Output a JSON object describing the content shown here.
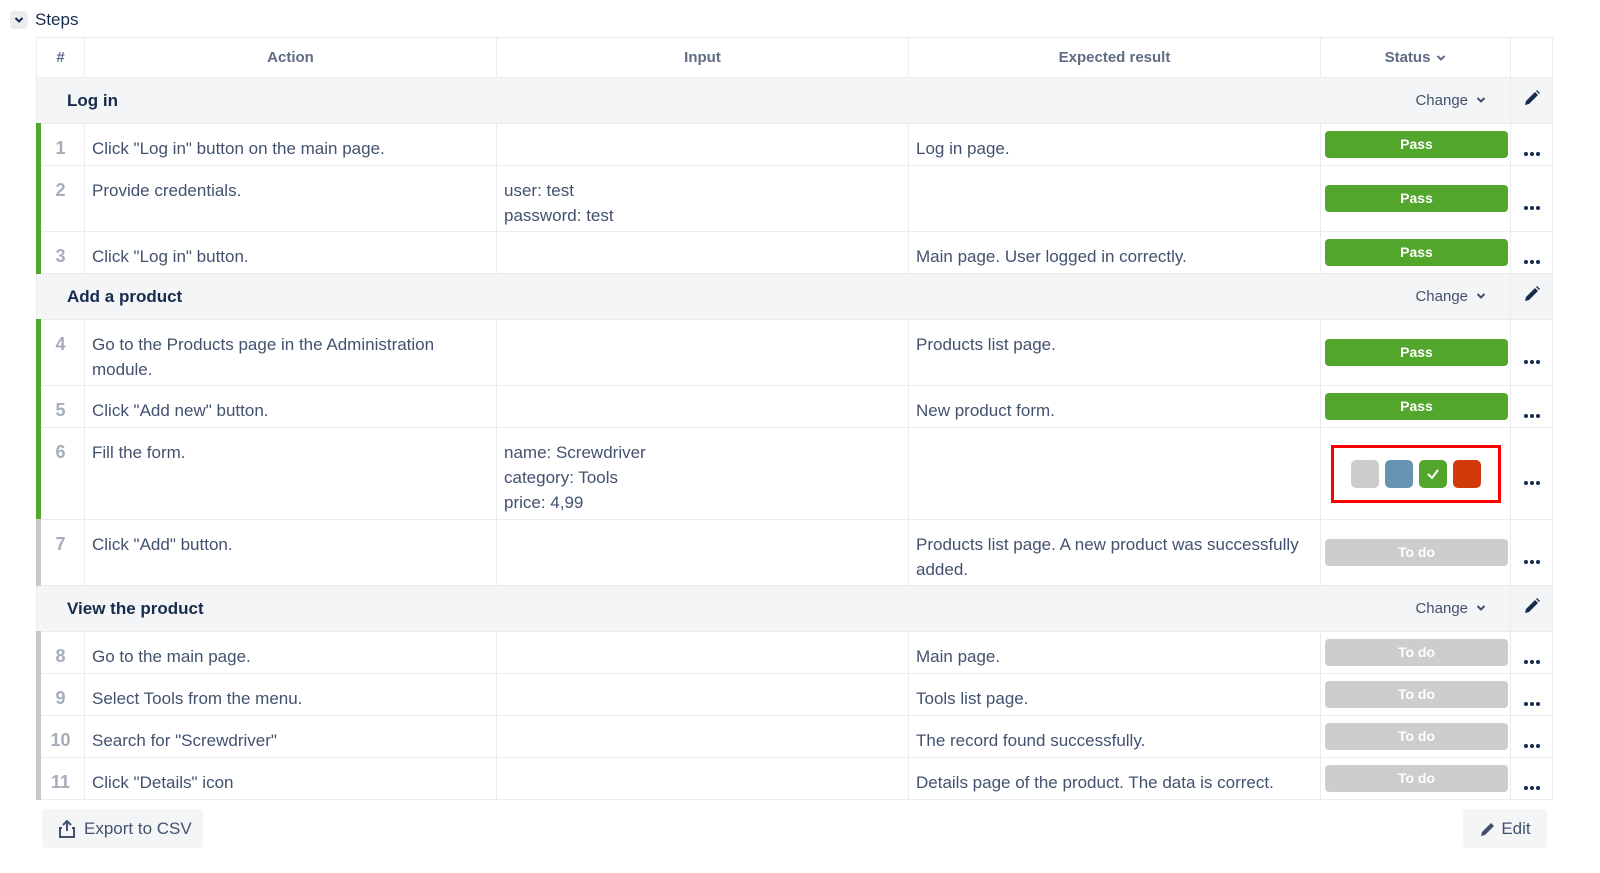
{
  "section": {
    "title": "Steps",
    "collapse_icon": "chevron-down-icon"
  },
  "table": {
    "headers": {
      "num": "#",
      "action": "Action",
      "input": "Input",
      "expected": "Expected result",
      "status": "Status"
    },
    "groups": [
      {
        "title": "Log in",
        "change_label": "Change",
        "steps": [
          {
            "num": "1",
            "action": "Click \"Log in\" button on the main page.",
            "input": [],
            "expected": "Log in page.",
            "status": "Pass"
          },
          {
            "num": "2",
            "action": "Provide credentials.",
            "input": [
              "user: test",
              "password: test"
            ],
            "expected": "",
            "status": "Pass"
          },
          {
            "num": "3",
            "action": "Click \"Log in\" button.",
            "input": [],
            "expected": "Main page. User logged in correctly.",
            "status": "Pass"
          }
        ]
      },
      {
        "title": "Add a product",
        "change_label": "Change",
        "steps": [
          {
            "num": "4",
            "action": "Go to the Products page in the Administration module.",
            "input": [],
            "expected": "Products list page.",
            "status": "Pass"
          },
          {
            "num": "5",
            "action": "Click \"Add new\" button.",
            "input": [],
            "expected": "New product form.",
            "status": "Pass"
          },
          {
            "num": "6",
            "action": "Fill the form.",
            "input": [
              "name: Screwdriver",
              "category: Tools",
              "price: 4,99"
            ],
            "expected": "",
            "status": "picker"
          },
          {
            "num": "7",
            "action": "Click \"Add\" button.",
            "input": [],
            "expected": "Products list page. A new product was successfully added.",
            "status": "To do"
          }
        ]
      },
      {
        "title": "View the product",
        "change_label": "Change",
        "steps": [
          {
            "num": "8",
            "action": "Go to the main page.",
            "input": [],
            "expected": "Main page.",
            "status": "To do"
          },
          {
            "num": "9",
            "action": "Select Tools from the menu.",
            "input": [],
            "expected": "Tools list page.",
            "status": "To do"
          },
          {
            "num": "10",
            "action": "Search for \"Screwdriver\"",
            "input": [],
            "expected": "The record found successfully.",
            "status": "To do"
          },
          {
            "num": "11",
            "action": "Click \"Details\" icon",
            "input": [],
            "expected": "Details page of the product. The data is correct.",
            "status": "To do"
          }
        ]
      }
    ]
  },
  "status_picker": {
    "options": [
      {
        "name": "to-do",
        "color": "#cccccc"
      },
      {
        "name": "in-progress",
        "color": "#6793b3"
      },
      {
        "name": "pass",
        "color": "#52a62b",
        "selected": true
      },
      {
        "name": "fail",
        "color": "#d13b0b"
      }
    ],
    "highlight_color": "#ff0000"
  },
  "colors": {
    "pass": "#52a62b",
    "todo": "#cdcdcd"
  },
  "footer": {
    "export_label": "Export to CSV",
    "edit_label": "Edit"
  }
}
